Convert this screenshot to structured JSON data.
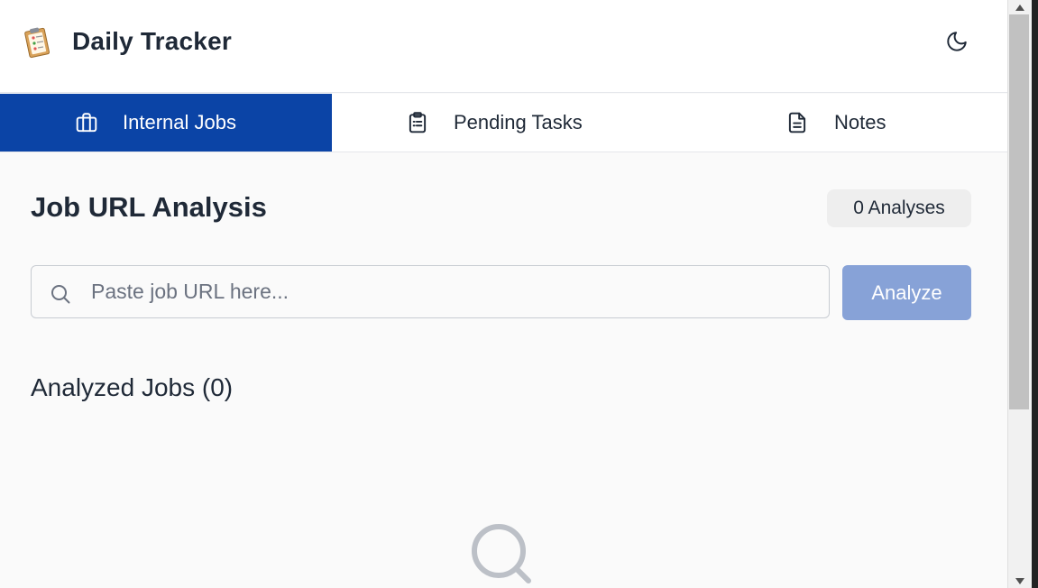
{
  "header": {
    "title": "Daily Tracker",
    "logo_icon": "clipboard-logo-icon",
    "theme_toggle_icon": "moon-icon"
  },
  "tabs": [
    {
      "label": "Internal Jobs",
      "icon": "briefcase-icon",
      "active": true
    },
    {
      "label": "Pending Tasks",
      "icon": "clipboard-list-icon",
      "active": false
    },
    {
      "label": "Notes",
      "icon": "document-icon",
      "active": false
    }
  ],
  "main": {
    "title": "Job URL Analysis",
    "count_badge": "0 Analyses",
    "search": {
      "placeholder": "Paste job URL here...",
      "value": "",
      "icon": "search-icon"
    },
    "analyze_label": "Analyze",
    "list_title": "Analyzed Jobs (0)",
    "empty_icon": "search-icon"
  },
  "colors": {
    "accent": "#0b44a6",
    "button_disabled": "#87a2d7",
    "background": "#fafafa"
  }
}
